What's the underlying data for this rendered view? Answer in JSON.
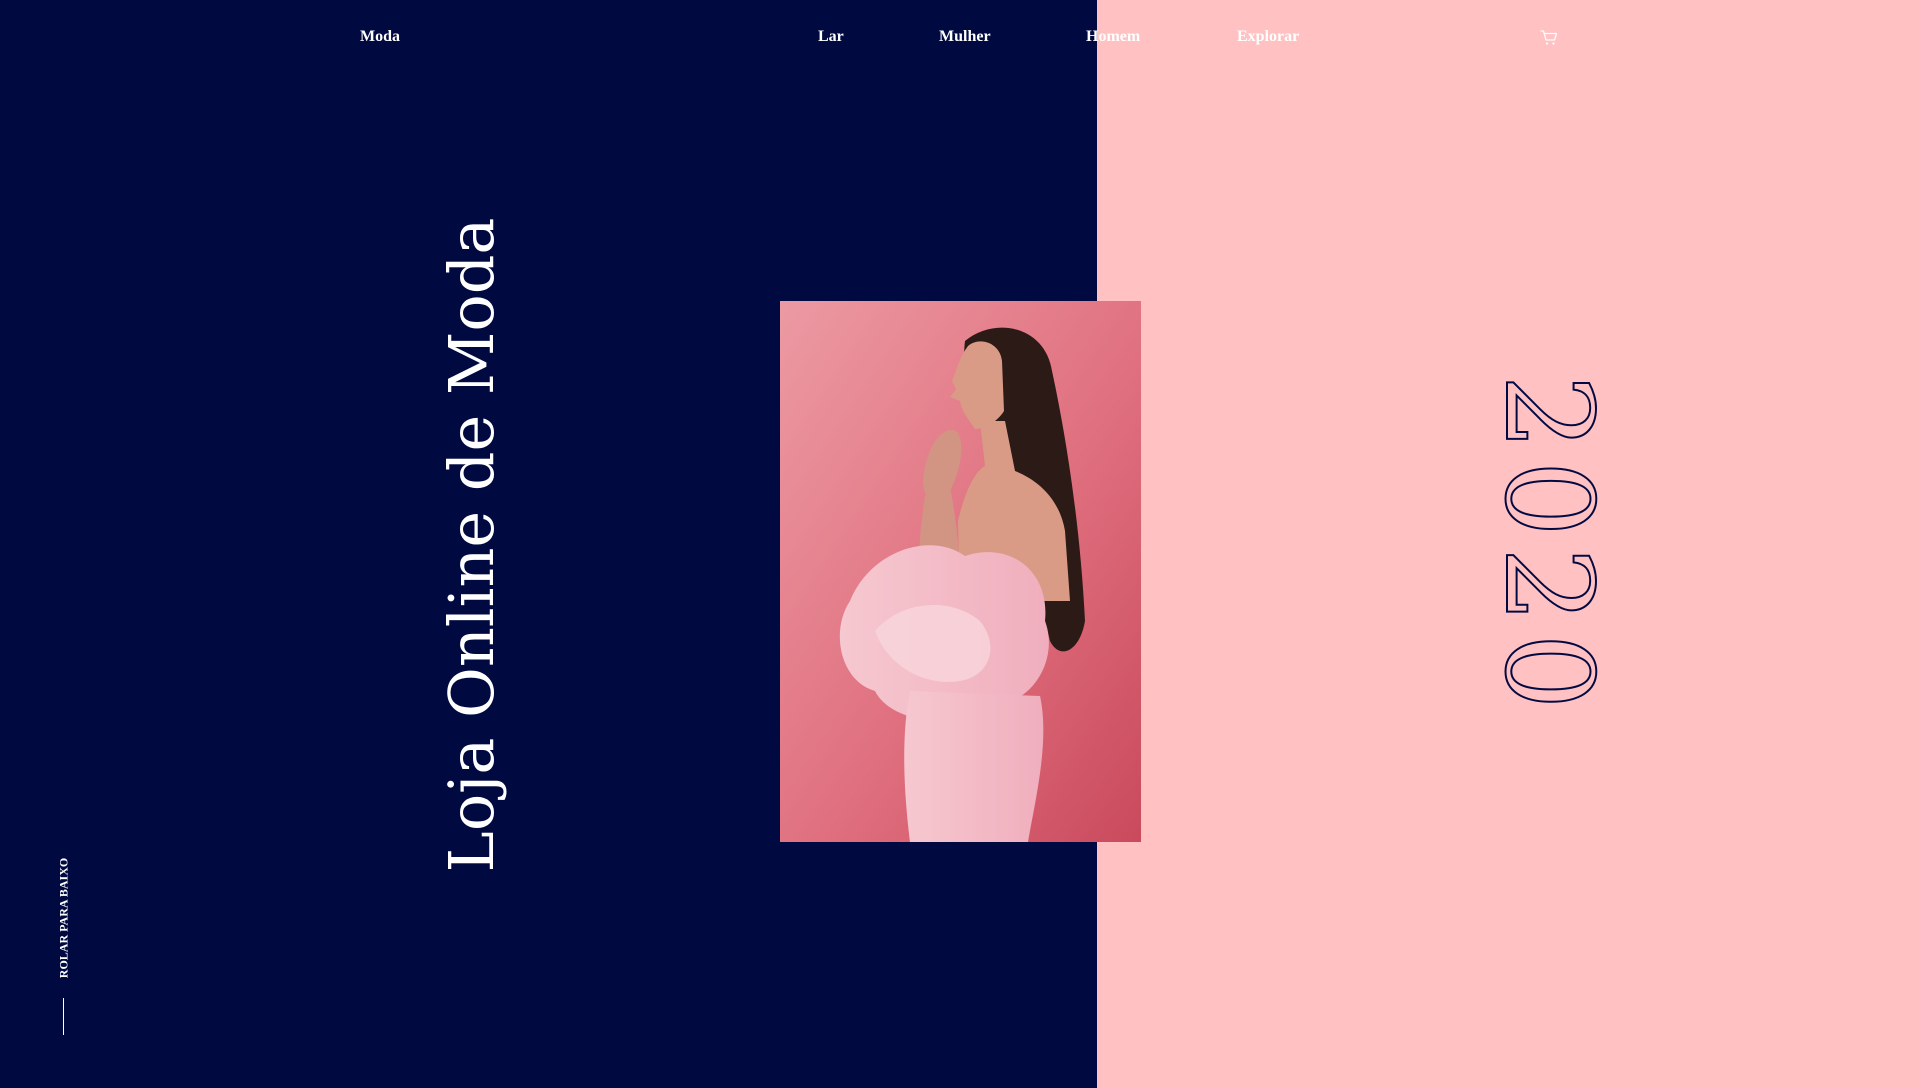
{
  "colors": {
    "left_bg": "#000a40",
    "right_bg": "#ffc1c2",
    "nav_text": "#ffffff",
    "year_stroke": "#020a42"
  },
  "header": {
    "brand": "Moda",
    "nav": [
      "Lar",
      "Mulher",
      "Homem",
      "Explorar"
    ],
    "cart_icon": "shopping-cart-icon"
  },
  "hero": {
    "title": "Loja Online de Moda",
    "year": "2020"
  },
  "scroll": {
    "label": "ROLAR PARA BAIXO"
  }
}
